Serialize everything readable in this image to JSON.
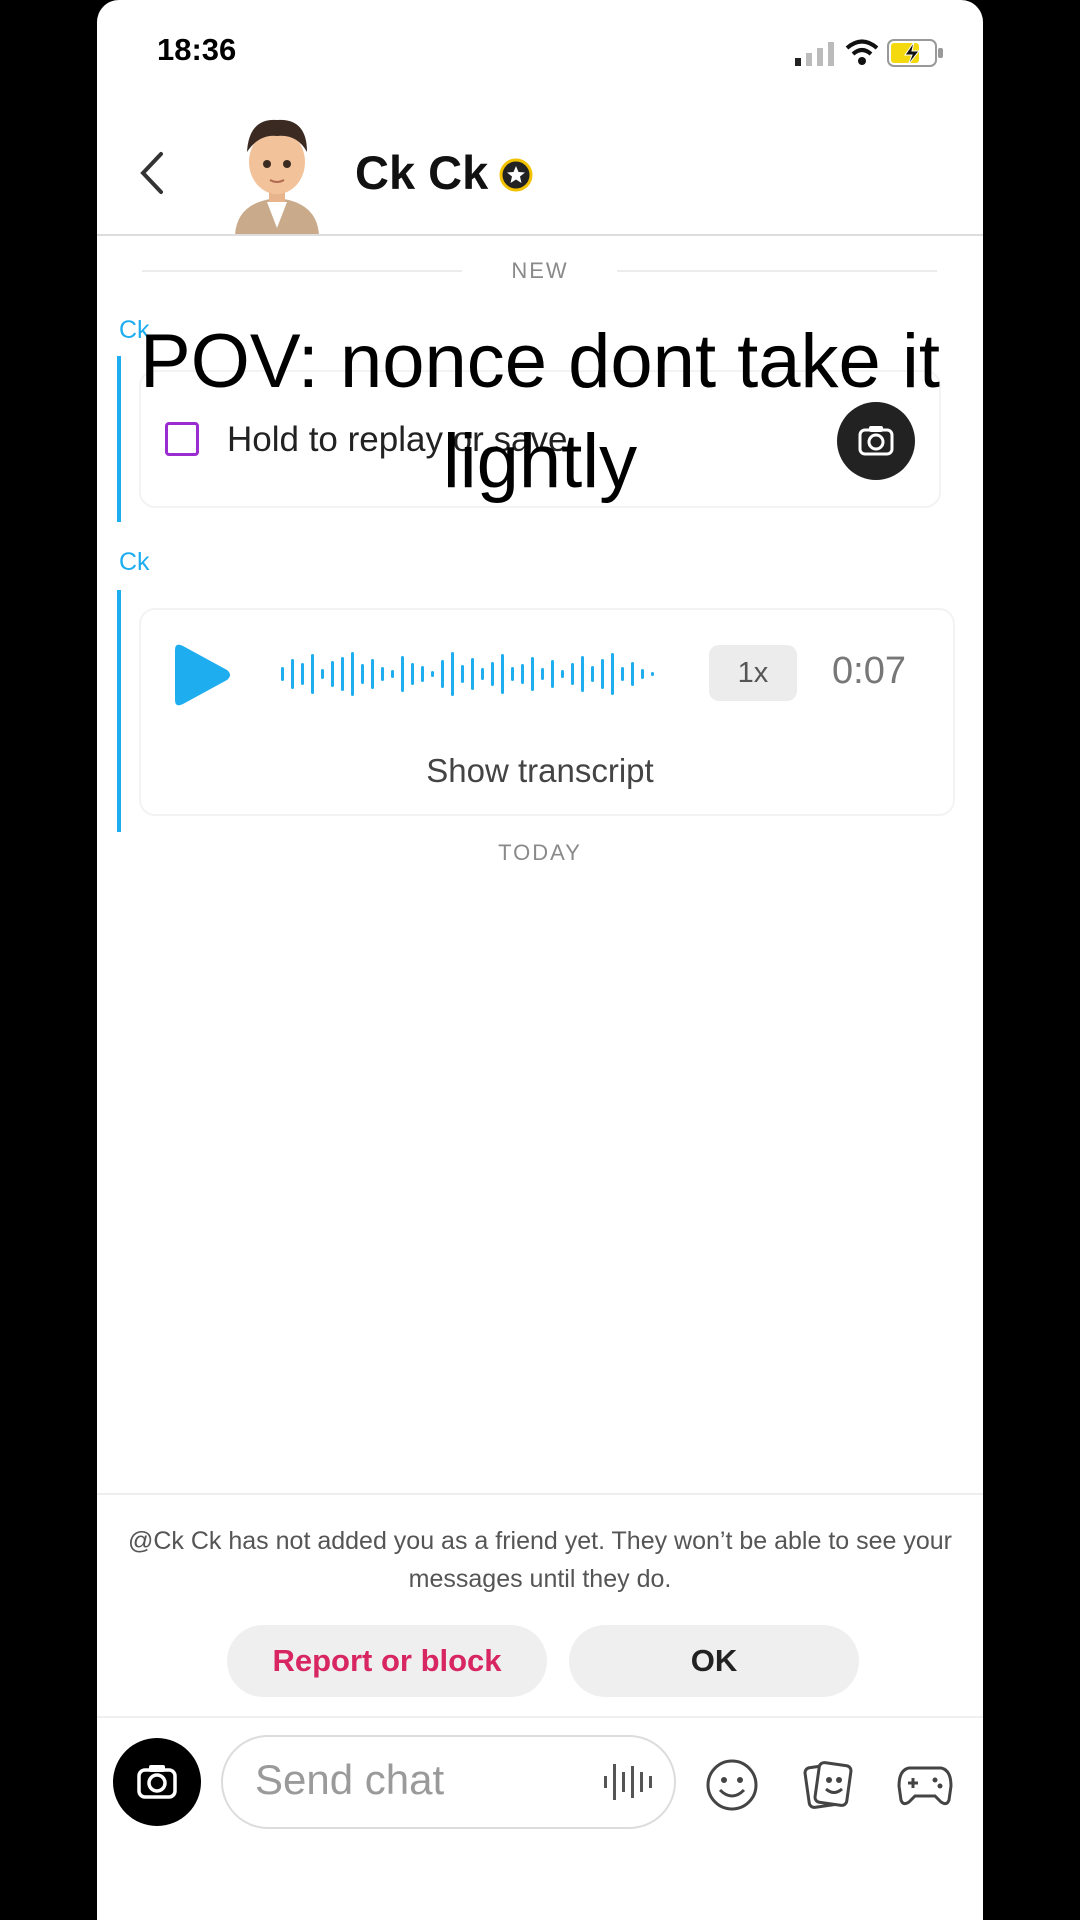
{
  "status_bar": {
    "time": "18:36"
  },
  "header": {
    "contact_name": "Ck Ck"
  },
  "dividers": {
    "new": "NEW",
    "today": "TODAY"
  },
  "caption": {
    "line1": "POV: nonce dont take it",
    "line2": "lightly"
  },
  "messages": [
    {
      "sender": "Ck",
      "type": "snap",
      "text": "Hold to replay or save"
    },
    {
      "sender": "Ck",
      "type": "voice",
      "speed": "1x",
      "duration": "0:07",
      "transcript_label": "Show transcript"
    }
  ],
  "notice": {
    "text": "@Ck Ck has not added you as a friend yet. They won’t be able to see your messages until they do.",
    "report_label": "Report or block",
    "ok_label": "OK"
  },
  "input_bar": {
    "placeholder": "Send chat"
  },
  "colors": {
    "accent_blue": "#1eaef0",
    "report_red": "#d72661",
    "snap_purple": "#9b2ccf"
  }
}
